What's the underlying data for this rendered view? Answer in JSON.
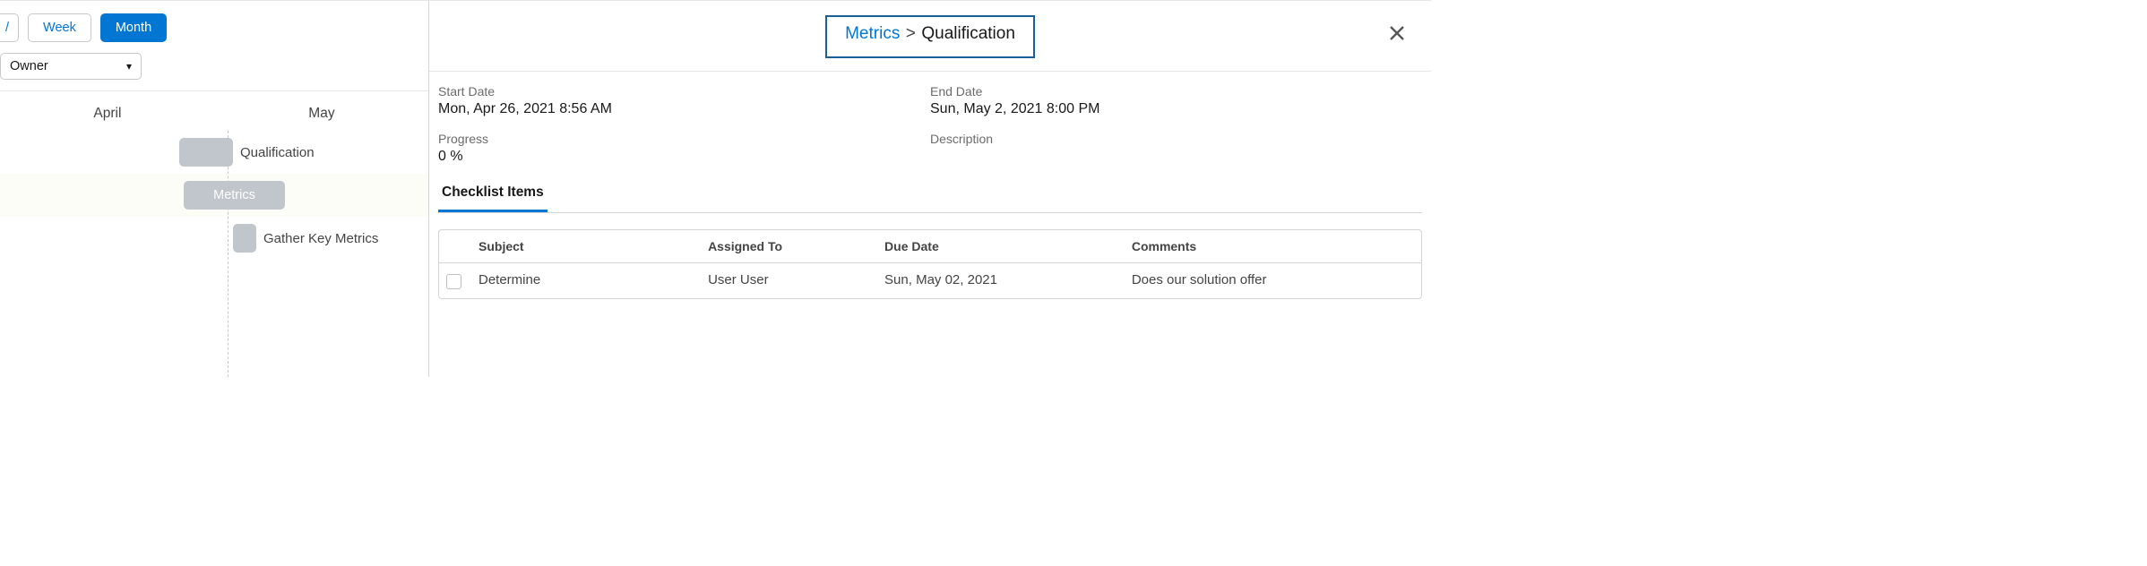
{
  "toolbar": {
    "partial_button": "/",
    "week_button": "Week",
    "month_button": "Month"
  },
  "owner_select": {
    "label": "Owner"
  },
  "calendar": {
    "months": [
      "April",
      "May"
    ],
    "rows": [
      {
        "bar_label": "",
        "trailing_label": "Qualification"
      },
      {
        "bar_label": "Metrics"
      },
      {
        "trailing_label": "Gather Key Metrics"
      }
    ]
  },
  "breadcrumb": {
    "parent": "Metrics",
    "separator": ">",
    "current": "Qualification"
  },
  "details": {
    "start_date_label": "Start Date",
    "start_date_value": "Mon, Apr 26, 2021 8:56 AM",
    "end_date_label": "End Date",
    "end_date_value": "Sun, May 2, 2021 8:00 PM",
    "progress_label": "Progress",
    "progress_value": "0 %",
    "description_label": "Description",
    "description_value": ""
  },
  "tabs": {
    "checklist": "Checklist Items"
  },
  "table": {
    "headers": {
      "subject": "Subject",
      "assigned_to": "Assigned To",
      "due_date": "Due Date",
      "comments": "Comments"
    },
    "rows": [
      {
        "subject": "Determine",
        "assigned_to": "User User",
        "due_date": "Sun, May 02, 2021",
        "comments": "Does our solution offer"
      }
    ]
  }
}
